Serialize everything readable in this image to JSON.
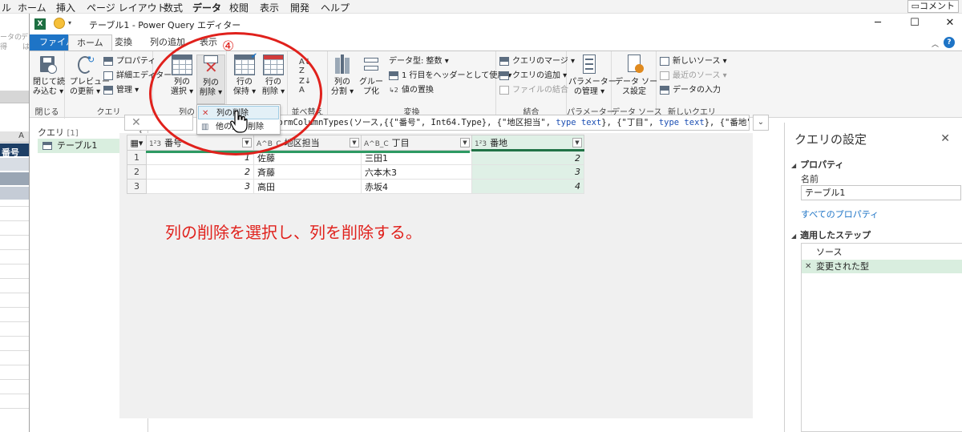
{
  "excel": {
    "menu": [
      "ル",
      "ホーム",
      "挿入",
      "ページ レイアウト",
      "数式",
      "データ",
      "校閲",
      "表示",
      "開発",
      "ヘルプ"
    ],
    "comment_label": "コメント",
    "col_label": "A",
    "row_header": "番号",
    "partial_texts": [
      "ータの",
      "デ",
      "得",
      "は"
    ]
  },
  "window": {
    "title": "テーブル1 - Power Query エディター",
    "minimize": "─",
    "maximize": "☐",
    "close": "✕"
  },
  "tabs": {
    "file": "ファイル",
    "home": "ホーム",
    "transform": "変換",
    "add_column": "列の追加",
    "view": "表示",
    "help": "?"
  },
  "ribbon": {
    "close_group": {
      "label": "閉じる",
      "close_load": [
        "閉じて読",
        "み込む ▾"
      ]
    },
    "query_group": {
      "label": "クエリ",
      "refresh_preview": [
        "プレビュー",
        "の更新 ▾"
      ],
      "properties": "プロパティ",
      "advanced_editor": "詳細エディター",
      "manage": "管理 ▾"
    },
    "column_group": {
      "label": "列の",
      "choose_columns": [
        "列の",
        "選択 ▾"
      ],
      "remove_columns": [
        "列の",
        "削除 ▾"
      ]
    },
    "reduce_group": {
      "keep_rows": [
        "行の",
        "保持 ▾"
      ],
      "remove_rows": [
        "行の",
        "削除 ▾"
      ]
    },
    "sort_group": {
      "label": "並べ替え"
    },
    "transform_group": {
      "label": "変換",
      "split_column": [
        "列の",
        "分割 ▾"
      ],
      "group_by": [
        "グルー",
        "プ化"
      ],
      "data_type": "データ型: 整数 ▾",
      "use_first_row": "1 行目をヘッダーとして使用 ▾",
      "replace_values": "値の置換"
    },
    "combine_group": {
      "label": "結合",
      "merge_queries": "クエリのマージ ▾",
      "append_queries": "クエリの追加 ▾",
      "combine_files": "ファイルの結合"
    },
    "parameters_group": {
      "label": "パラメーター",
      "manage_params": [
        "パラメーター",
        "の管理 ▾"
      ]
    },
    "datasource_group": {
      "label": "データ ソース",
      "source_settings": [
        "データ ソー",
        "ス設定"
      ]
    },
    "newquery_group": {
      "label": "新しいクエリ",
      "new_source": "新しいソース ▾",
      "recent_sources": "最近のソース ▾",
      "enter_data": "データの入力"
    }
  },
  "dropdown": {
    "remove_columns": "列の削除",
    "remove_other_columns": "他の列の削除"
  },
  "formula": {
    "cancel": "✕",
    "text_prefix": "= Table.TransformColumnTypes(ソース,{{\"番号\", Int64.Type}, {\"地区担当\", ",
    "kw1": "type text",
    "text_mid": "}, {\"丁目\", ",
    "kw2": "type text",
    "text_suffix": "}, {\"番地\",",
    "expand": "⌄"
  },
  "queries": {
    "header": "クエリ",
    "count": "[1]",
    "collapse": "‹",
    "items": [
      "テーブル1"
    ]
  },
  "grid": {
    "columns": [
      {
        "type": "1²3",
        "name": "番号"
      },
      {
        "type": "A^B_C",
        "name": "地区担当"
      },
      {
        "type": "A^B_C",
        "name": "丁目"
      },
      {
        "type": "1²3",
        "name": "番地"
      }
    ],
    "rows": [
      {
        "n": "1",
        "cells": [
          "1",
          "佐藤",
          "三田1",
          "2"
        ]
      },
      {
        "n": "2",
        "cells": [
          "2",
          "斉藤",
          "六本木3",
          "3"
        ]
      },
      {
        "n": "3",
        "cells": [
          "3",
          "高田",
          "赤坂4",
          "4"
        ]
      }
    ]
  },
  "annotation": {
    "number": "④",
    "text": "列の削除を選択し、列を削除する。",
    "color": "#e0211c"
  },
  "settings": {
    "title": "クエリの設定",
    "close": "✕",
    "properties_header": "プロパティ",
    "name_label": "名前",
    "name_value": "テーブル1",
    "all_properties": "すべてのプロパティ",
    "steps_header": "適用したステップ",
    "steps": [
      "ソース",
      "変更された型"
    ]
  },
  "colors": {
    "accent_blue": "#1e74c6",
    "excel_green": "#217346",
    "selected_col": "#dff0e6"
  }
}
